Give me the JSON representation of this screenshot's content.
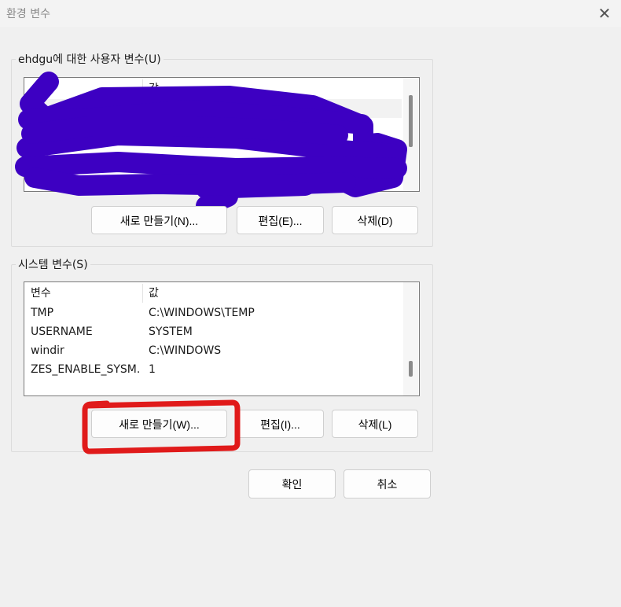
{
  "window": {
    "title": "환경 변수",
    "close_glyph": "✕"
  },
  "user_vars": {
    "group_label": "ehdgu에 대한 사용자 변수(U)",
    "header_value": "값",
    "buttons": {
      "new": "새로 만들기(N)...",
      "edit": "편집(E)...",
      "delete": "삭제(D)"
    }
  },
  "system_vars": {
    "group_label": "시스템 변수(S)",
    "headers": {
      "name": "변수",
      "value": "값"
    },
    "rows": [
      {
        "name": "TMP",
        "value": "C:\\WINDOWS\\TEMP"
      },
      {
        "name": "USERNAME",
        "value": "SYSTEM"
      },
      {
        "name": "windir",
        "value": "C:\\WINDOWS"
      },
      {
        "name": "ZES_ENABLE_SYSM...",
        "value": "1"
      }
    ],
    "buttons": {
      "new": "새로 만들기(W)...",
      "edit": "편집(I)...",
      "delete": "삭제(L)"
    }
  },
  "dialog_buttons": {
    "ok": "확인",
    "cancel": "취소"
  },
  "colors": {
    "redaction": "#3d00c2",
    "highlight": "#e01a1a"
  }
}
